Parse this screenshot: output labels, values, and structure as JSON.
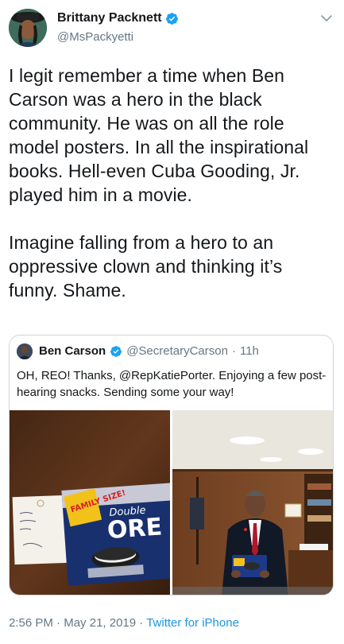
{
  "author": {
    "name": "Brittany Packnett",
    "handle": "@MsPackyetti",
    "avatar_icon": "user-avatar"
  },
  "tweet": {
    "paragraph_1": "I legit remember a time when Ben Carson was a hero in the black community. He was on all the role model posters. In all the inspirational books. Hell-even Cuba Gooding, Jr. played him in a movie.",
    "paragraph_2": "Imagine falling from a hero to an oppressive clown and thinking it’s funny. Shame."
  },
  "quoted_tweet": {
    "name": "Ben Carson",
    "handle": "@SecretaryCarson",
    "separator": "·",
    "time": "11h",
    "text": "OH, REO! Thanks, @RepKatiePorter. Enjoying a few post-hearing snacks. Sending some your way!",
    "media": {
      "left_image": "oreo-package-photo",
      "right_image": "man-holding-oreos-photo",
      "package_text": "Double OREO",
      "banner_text": "FAMILY SIZE!"
    }
  },
  "footer": {
    "time": "2:56 PM",
    "dot1": " · ",
    "date": "May 21, 2019",
    "dot2": " · ",
    "source": "Twitter for iPhone"
  },
  "colors": {
    "verified": "#1da1f2",
    "link": "#1b95e0",
    "secondary_text": "#657786",
    "border": "#ccd6dd"
  }
}
